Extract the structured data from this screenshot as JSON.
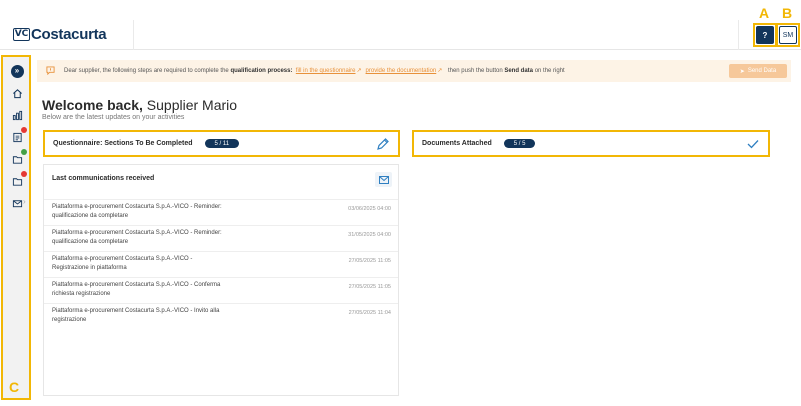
{
  "header": {
    "logo_text": "Costacurta",
    "logo_mark": "VC",
    "help_label": "?",
    "user_initials": "SM"
  },
  "markers": {
    "a": "A",
    "b": "B",
    "c": "C"
  },
  "sidebar": {
    "items": [
      {
        "icon": "expand-icon",
        "label": "»"
      },
      {
        "icon": "home-icon"
      },
      {
        "icon": "chart-icon"
      },
      {
        "icon": "questionnaire-icon",
        "badge_color": "#e53935"
      },
      {
        "icon": "documents-icon",
        "badge_color": "#43a047"
      },
      {
        "icon": "folder-icon",
        "badge_color": "#e53935"
      },
      {
        "icon": "mail-icon",
        "chevron": "›"
      }
    ]
  },
  "notice": {
    "text_before": "Dear supplier, the following steps are required to complete the ",
    "bold1": "qualification process:",
    "link1": "fill in the questionnaire",
    "link2": "provide the documentation",
    "text_after": " then push the button ",
    "bold2": "Send data",
    "text_end": " on the right",
    "send_button": "Send Data"
  },
  "welcome": {
    "greeting": "Welcome back,",
    "name": "Supplier Mario",
    "subtitle": "Below are the latest updates on your activities"
  },
  "cards": {
    "questionnaire": {
      "title": "Questionnaire: Sections To Be Completed",
      "count": "5 / 11"
    },
    "documents": {
      "title": "Documents Attached",
      "count": "5 / 5"
    }
  },
  "communications": {
    "title": "Last communications received",
    "items": [
      {
        "line1": "Piattaforma e-procurement Costacurta S.p.A.-VICO - Reminder:",
        "line2": "qualificazione da completare",
        "date": "03/06/2025 04:00"
      },
      {
        "line1": "Piattaforma e-procurement Costacurta S.p.A.-VICO - Reminder:",
        "line2": "qualificazione da completare",
        "date": "31/05/2025 04:00"
      },
      {
        "line1": "Piattaforma e-procurement Costacurta S.p.A.-VICO -",
        "line2": "Registrazione in piattaforma",
        "date": "27/05/2025 11:05"
      },
      {
        "line1": "Piattaforma e-procurement Costacurta S.p.A.-VICO - Conferma",
        "line2": "richiesta registrazione",
        "date": "27/05/2025 11:05"
      },
      {
        "line1": "Piattaforma e-procurement Costacurta S.p.A.-VICO - Invito alla",
        "line2": "registrazione",
        "date": "27/05/2025 11:04"
      }
    ]
  },
  "colors": {
    "brand": "#12355b",
    "accent_orange": "#e8913a",
    "highlight": "#f2b705",
    "notice_bg": "#fdf3e6"
  }
}
